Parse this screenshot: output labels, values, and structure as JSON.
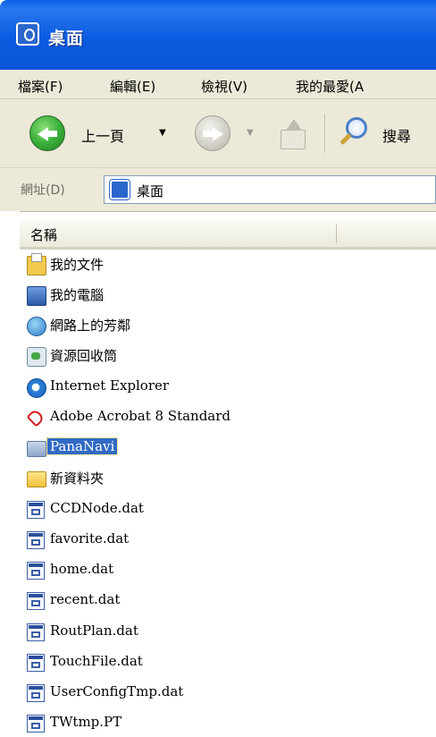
{
  "window": {
    "title": "桌面"
  },
  "menu": {
    "items": [
      "檔案(F)",
      "編輯(E)",
      "檢視(V)",
      "我的最愛(A"
    ]
  },
  "toolbar": {
    "back_label": "上一頁",
    "search_label": "搜尋"
  },
  "address": {
    "label": "網址(D)",
    "value": "桌面"
  },
  "columns": {
    "name": "名稱"
  },
  "files": [
    {
      "label": "我的文件",
      "icon": "my-documents-icon"
    },
    {
      "label": "我的電腦",
      "icon": "my-computer-icon"
    },
    {
      "label": "網路上的芳鄰",
      "icon": "network-places-icon"
    },
    {
      "label": "資源回收筒",
      "icon": "recycle-bin-icon"
    },
    {
      "label": "Internet Explorer",
      "icon": "internet-explorer-icon"
    },
    {
      "label": "Adobe Acrobat 8 Standard",
      "icon": "adobe-acrobat-icon"
    },
    {
      "label": "PanaNavi",
      "icon": "folder-icon",
      "selected": true
    },
    {
      "label": "新資料夾",
      "icon": "folder-icon"
    },
    {
      "label": "CCDNode.dat",
      "icon": "dat-file-icon"
    },
    {
      "label": "favorite.dat",
      "icon": "dat-file-icon"
    },
    {
      "label": "home.dat",
      "icon": "dat-file-icon"
    },
    {
      "label": "recent.dat",
      "icon": "dat-file-icon"
    },
    {
      "label": "RoutPlan.dat",
      "icon": "dat-file-icon"
    },
    {
      "label": "TouchFile.dat",
      "icon": "dat-file-icon"
    },
    {
      "label": "UserConfigTmp.dat",
      "icon": "dat-file-icon"
    },
    {
      "label": "TWtmp.PT",
      "icon": "dat-file-icon"
    }
  ],
  "colors": {
    "titlebar": "#0a5be0",
    "selection": "#316ac5",
    "chrome": "#ece9d8"
  }
}
